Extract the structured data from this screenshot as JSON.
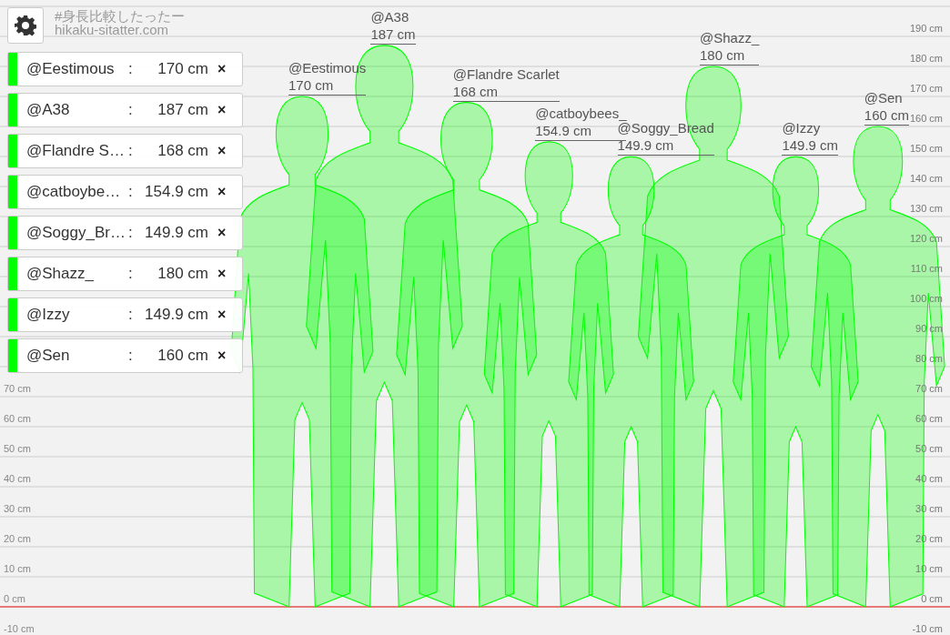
{
  "site_title": "#身長比較したったー",
  "site_url": "hikaku-sitatter.com",
  "scale": {
    "left_labels": [
      "70 cm",
      "60 cm",
      "50 cm",
      "40 cm",
      "30 cm",
      "20 cm",
      "10 cm",
      "0 cm",
      "-10 cm"
    ],
    "right_labels": [
      "190 cm",
      "180 cm",
      "170 cm",
      "160 cm",
      "150 cm",
      "140 cm",
      "130 cm",
      "120 cm",
      "110 cm",
      "100 cm",
      "90 cm",
      "80 cm",
      "70 cm",
      "60 cm",
      "50 cm",
      "40 cm",
      "30 cm",
      "20 cm",
      "10 cm",
      "0 cm",
      "-10 cm"
    ]
  },
  "people": [
    {
      "card_name": "@Eestimous",
      "card_height": "170 cm",
      "name": "@Eestimous",
      "height": "170 cm",
      "color": "#00ff00"
    },
    {
      "card_name": "@A38",
      "card_height": "187 cm",
      "name": "@A38",
      "height": "187 cm",
      "color": "#00ff00"
    },
    {
      "card_name": "@Flandre S…",
      "card_height": "168 cm",
      "name": "@Flandre Scarlet",
      "height": "168 cm",
      "color": "#00ff00"
    },
    {
      "card_name": "@catboybe…",
      "card_height": "154.9 cm",
      "name": "@catboybees_",
      "height": "154.9 cm",
      "color": "#00ff00"
    },
    {
      "card_name": "@Soggy_Br…",
      "card_height": "149.9 cm",
      "name": "@Soggy_Bread",
      "height": "149.9 cm",
      "color": "#00ff00"
    },
    {
      "card_name": "@Shazz_",
      "card_height": "180 cm",
      "name": "@Shazz_",
      "height": "180 cm",
      "color": "#00ff00"
    },
    {
      "card_name": "@Izzy",
      "card_height": "149.9 cm",
      "name": "@Izzy",
      "height": "149.9 cm",
      "color": "#00ff00"
    },
    {
      "card_name": "@Sen",
      "card_height": "160 cm",
      "name": "@Sen",
      "height": "160 cm",
      "color": "#00ff00"
    }
  ],
  "remove_symbol": "×",
  "separator": ":"
}
